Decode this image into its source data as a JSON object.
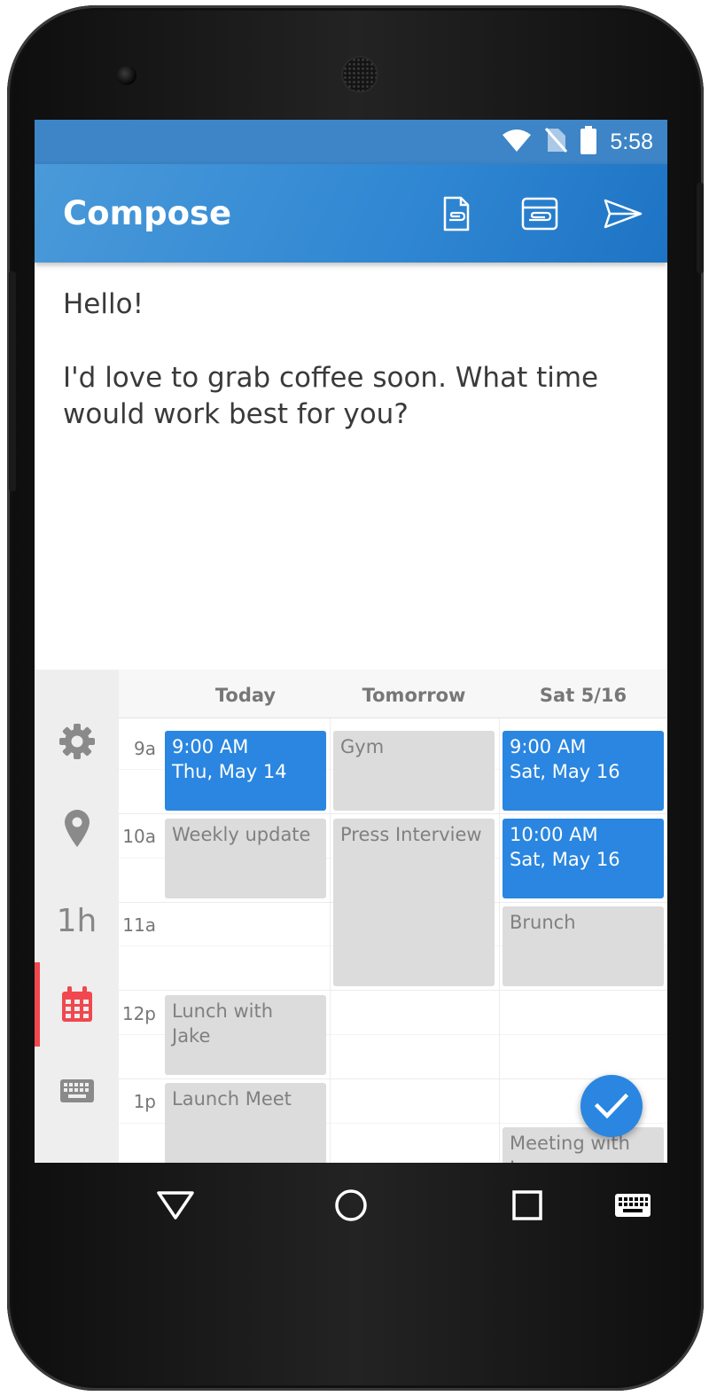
{
  "status_bar": {
    "time": "5:58",
    "icons": [
      "wifi-icon",
      "no-sim-icon",
      "battery-icon"
    ]
  },
  "app_bar": {
    "title": "Compose",
    "actions": [
      "attach-file-icon",
      "attach-card-icon",
      "send-icon"
    ]
  },
  "compose": {
    "line1": "Hello!",
    "line2": "I'd love to grab coffee soon. What time would work best for you?"
  },
  "rail": {
    "items": [
      "gear-icon",
      "location-pin-icon",
      "duration",
      "calendar-icon",
      "keyboard-icon"
    ],
    "duration_label": "1h",
    "active": "calendar-icon",
    "active_color": "#f0484e"
  },
  "calendar": {
    "days": [
      "Today",
      "Tomorrow",
      "Sat 5/16"
    ],
    "hours": [
      "9a",
      "10a",
      "11a",
      "12p",
      "1p"
    ],
    "events": {
      "today_9": {
        "l1": "9:00 AM",
        "l2": "Thu, May 14"
      },
      "today_10": {
        "l1": "Weekly update"
      },
      "today_12": {
        "l1": "Lunch with",
        "l2": "Jake"
      },
      "today_1": {
        "l1": "Launch Meet"
      },
      "tom_9": {
        "l1": "Gym"
      },
      "tom_10": {
        "l1": "Press Interview"
      },
      "sat_9": {
        "l1": "9:00 AM",
        "l2": "Sat, May 16"
      },
      "sat_10": {
        "l1": "10:00 AM",
        "l2": "Sat, May 16"
      },
      "sat_11": {
        "l1": "Brunch"
      },
      "sat_130": {
        "l1": "Meeting with",
        "l2": "Jess"
      }
    },
    "colors": {
      "selected": "#2a86e0",
      "busy": "#dcdcdc"
    }
  },
  "nav": [
    "back-icon",
    "home-icon",
    "recents-icon",
    "keyboard-switch-icon"
  ],
  "colors": {
    "app_bar": "#3d85c6",
    "accent": "#2a86e0"
  }
}
